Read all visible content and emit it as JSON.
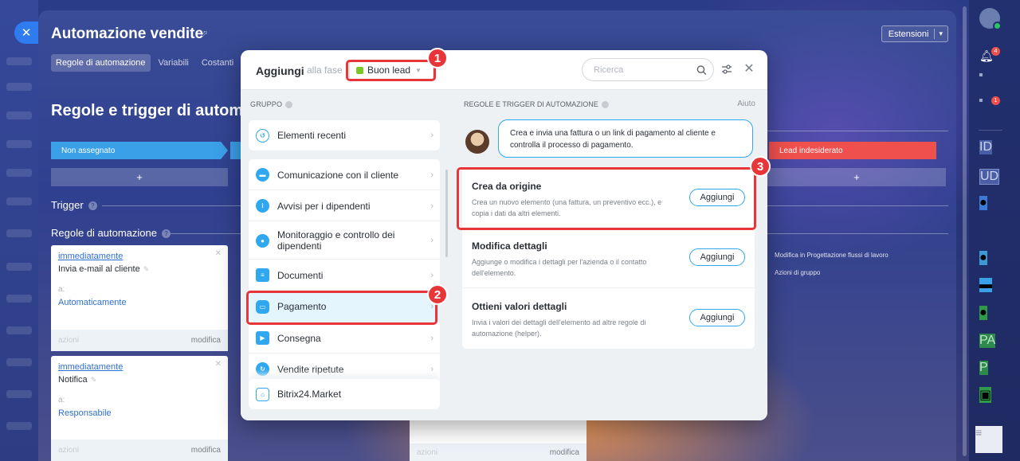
{
  "slider": {
    "title": "Automazione vendite",
    "extensions_label": "Estensioni",
    "tabs": [
      {
        "label": "Regole di automazione"
      },
      {
        "label": "Variabili"
      },
      {
        "label": "Costanti"
      }
    ],
    "section_title": "Regole e trigger di automaz",
    "stages": {
      "first": "Non assegnato",
      "last": "Lead indesiderato"
    },
    "plus": "+",
    "trigger_label": "Trigger",
    "rules_label": "Regole di automazione",
    "cards": [
      {
        "when": "immediatamente",
        "name": "Invia e-mail al cliente",
        "to_label": "a:",
        "to_value": "Automaticamente",
        "footer_left": "azioni",
        "footer_right": "modifica"
      },
      {
        "when": "immediatamente",
        "name": "Notifica",
        "to_label": "a:",
        "to_value": "Responsabile",
        "footer_left": "azioni",
        "footer_right": "modifica"
      }
    ],
    "bottom_card": {
      "footer_left": "azioni",
      "footer_right": "modifica"
    },
    "right_links": [
      "Modifica in Progettazione flussi di lavoro",
      "Azioni di gruppo"
    ],
    "close_glyph": "✕"
  },
  "modal": {
    "title": "Aggiungi",
    "stage_label": "alla fase",
    "stage_value": "Buon lead",
    "search_placeholder": "Ricerca",
    "group_header": "GRUPPO",
    "groups": [
      {
        "label": "Elementi recenti",
        "icon": "history-icon"
      },
      {
        "label": "Comunicazione con il cliente",
        "icon": "chat-icon"
      },
      {
        "label": "Avvisi per i dipendenti",
        "icon": "info-icon"
      },
      {
        "label": "Monitoraggio e controllo dei dipendenti",
        "icon": "people-icon"
      },
      {
        "label": "Documenti",
        "icon": "document-icon"
      },
      {
        "label": "Pagamento",
        "icon": "wallet-icon"
      },
      {
        "label": "Consegna",
        "icon": "truck-icon"
      },
      {
        "label": "Vendite ripetute",
        "icon": "repeat-icon"
      }
    ],
    "market_label": "Bitrix24.Market",
    "rules_header": "REGOLE E TRIGGER DI AUTOMAZIONE",
    "help_label": "Aiuto",
    "hint": "Crea e invia una fattura o un link di pagamento al cliente e controlla il processo di pagamento.",
    "actions": [
      {
        "title": "Crea da origine",
        "desc": "Crea un nuovo elemento (una fattura, un preventivo ecc.), e copia i dati da altri elementi.",
        "button": "Aggiungi"
      },
      {
        "title": "Modifica dettagli",
        "desc": "Aggiunge o modifica i dettagli per l'azienda o il contatto dell'elemento.",
        "button": "Aggiungi"
      },
      {
        "title": "Ottieni valori dettagli",
        "desc": "Invia i valori dei dettagli dell'elemento ad altre regole di automazione (helper).",
        "button": "Aggiungi"
      }
    ]
  },
  "annotations": [
    "1",
    "2",
    "3"
  ],
  "right_bar": {
    "badges": {
      "notifications": "4",
      "chat": "1"
    },
    "avatars": [
      "ID",
      "UD",
      "PA",
      "P"
    ]
  },
  "colors": {
    "accent": "#2fa8f0",
    "highlight": "#e8353a",
    "stage_green": "#7cc527",
    "stage_blue": "#3aa0e8",
    "stage_red": "#f0504d"
  }
}
